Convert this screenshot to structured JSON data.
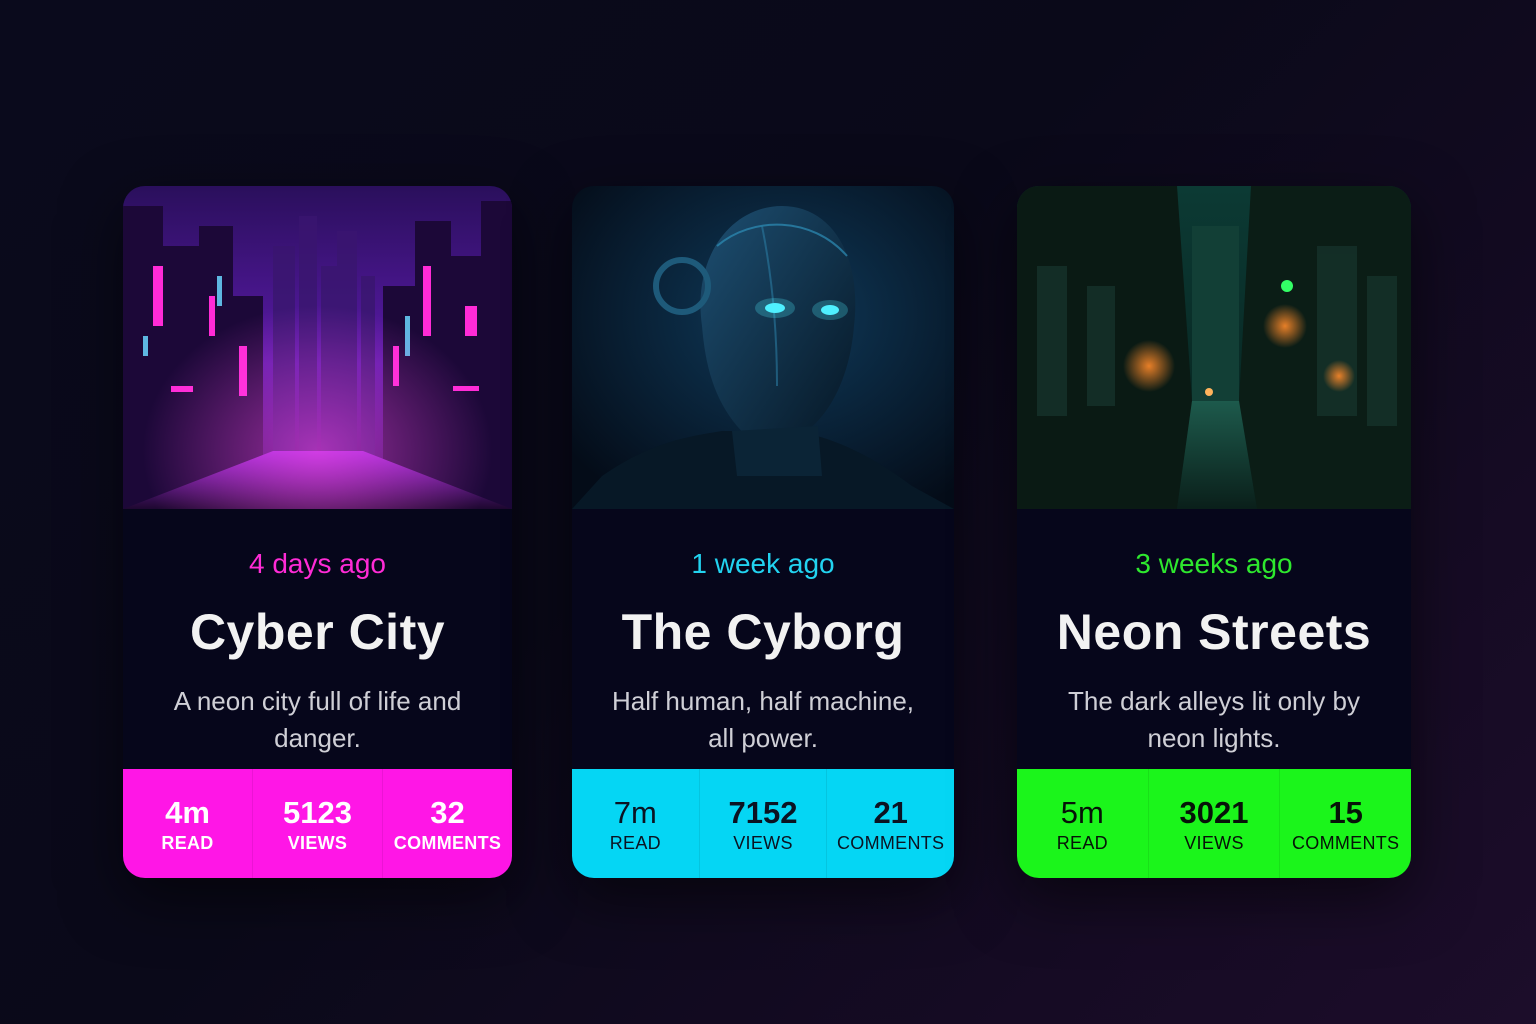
{
  "colors": {
    "magenta": "#ff16e6",
    "cyan": "#05d6f4",
    "green": "#1bf51b",
    "background": "#0a0a1c"
  },
  "cards": [
    {
      "time": "4 days ago",
      "title": "Cyber City",
      "description": "A neon city full of life and danger.",
      "image": "neon-city-street-illustration",
      "stats": [
        {
          "value": "4m",
          "label": "READ"
        },
        {
          "value": "5123",
          "label": "VIEWS"
        },
        {
          "value": "32",
          "label": "COMMENTS"
        }
      ]
    },
    {
      "time": "1 week ago",
      "title": "The Cyborg",
      "description": "Half human, half machine, all power.",
      "image": "cyborg-head-illustration",
      "stats": [
        {
          "value": "7m",
          "label": "READ"
        },
        {
          "value": "7152",
          "label": "VIEWS"
        },
        {
          "value": "21",
          "label": "COMMENTS"
        }
      ]
    },
    {
      "time": "3 weeks ago",
      "title": "Neon Streets",
      "description": "The dark alleys lit only by neon lights.",
      "image": "dark-alley-illustration",
      "stats": [
        {
          "value": "5m",
          "label": "READ"
        },
        {
          "value": "3021",
          "label": "VIEWS"
        },
        {
          "value": "15",
          "label": "COMMENTS"
        }
      ]
    }
  ]
}
